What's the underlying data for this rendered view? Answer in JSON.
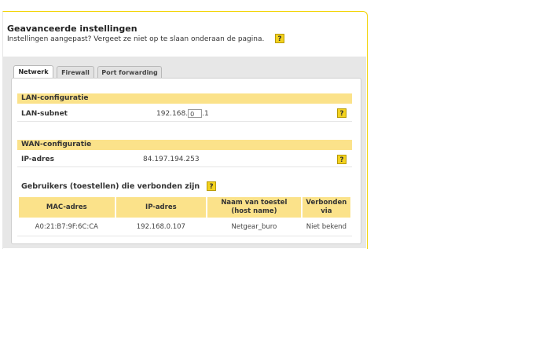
{
  "header": {
    "title": "Geavanceerde instellingen",
    "subtitle": "Instellingen aangepast? Vergeet ze niet op te slaan onderaan de pagina.",
    "help": "?"
  },
  "tabs": [
    {
      "label": "Netwerk",
      "active": true
    },
    {
      "label": "Firewall",
      "active": false
    },
    {
      "label": "Port forwarding",
      "active": false
    }
  ],
  "lan": {
    "heading": "LAN-configuratie",
    "label": "LAN-subnet",
    "prefix": "192.168.",
    "octet": "0",
    "suffix": ".1",
    "help": "?"
  },
  "wan": {
    "heading": "WAN-configuratie",
    "label": "IP-adres",
    "value": "84.197.194.253",
    "help": "?"
  },
  "users": {
    "title": "Gebruikers (toestellen) die verbonden zijn",
    "help": "?",
    "columns": [
      "MAC-adres",
      "IP-adres",
      "Naam van toestel",
      "(host name)",
      "Verbonden",
      "via"
    ],
    "rows": [
      {
        "mac": "A0:21:B7:9F:6C:CA",
        "ip": "192.168.0.107",
        "name": "Netgear_buro",
        "via": "Niet bekend"
      }
    ]
  },
  "colors": {
    "accent": "#f3d21f",
    "section": "#fbe28a",
    "border": "#f2d300"
  }
}
